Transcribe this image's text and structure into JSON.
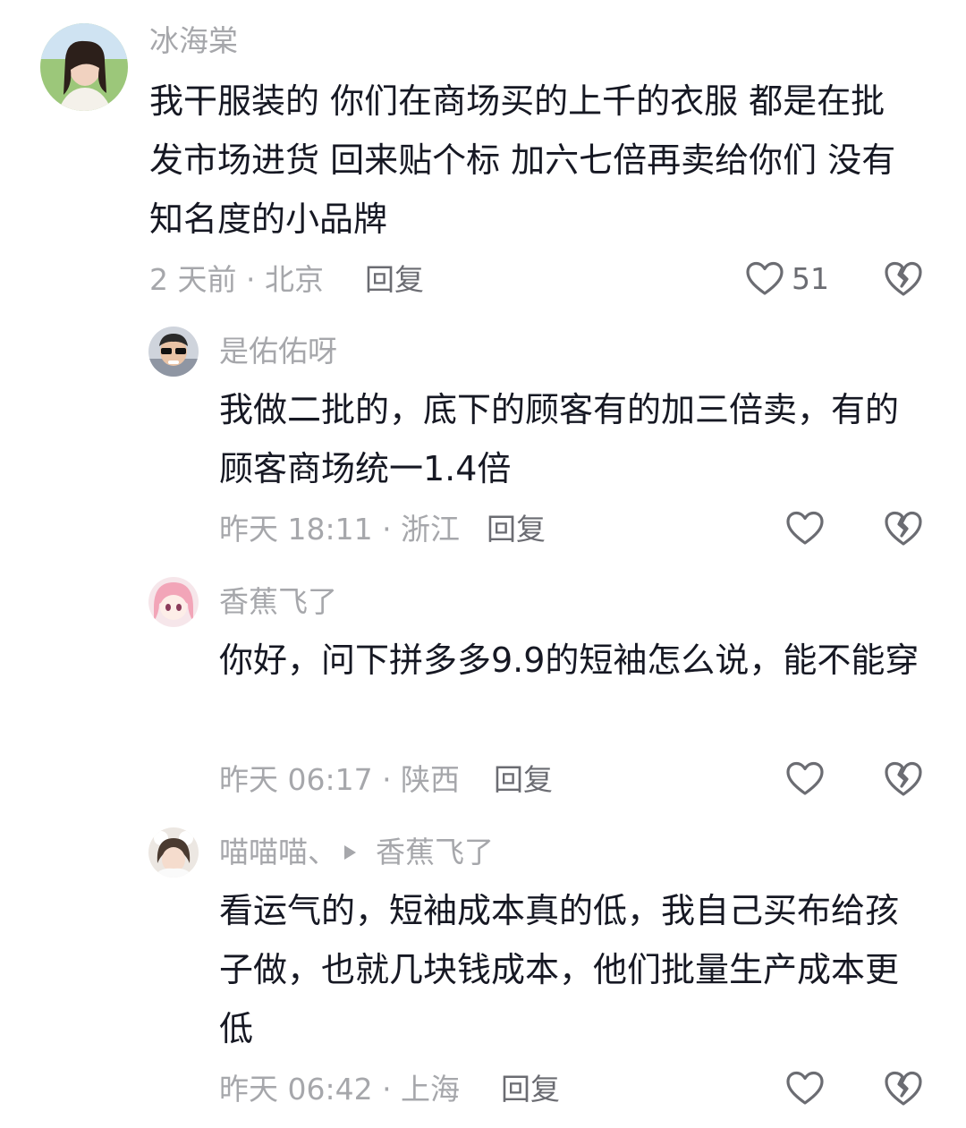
{
  "comments": [
    {
      "username": "冰海棠",
      "text": "我干服装的 你们在商场买的上千的衣服 都是在批发市场进货 回来贴个标 加六七倍再卖给你们 没有知名度的小品牌",
      "meta": "2 天前 · 北京",
      "reply_label": "回复",
      "likes": "51"
    },
    {
      "username": "是佑佑呀",
      "text": "我做二批的，底下的顾客有的加三倍卖，有的顾客商场统一1.4倍",
      "meta": "昨天 18:11 · 浙江",
      "reply_label": "回复",
      "likes": ""
    },
    {
      "username": "香蕉飞了",
      "text": "你好，问下拼多多9.9的短袖怎么说，能不能穿",
      "meta": "昨天 06:17 · 陕西",
      "reply_label": "回复",
      "likes": ""
    },
    {
      "username": "喵喵喵、",
      "reply_to": "香蕉飞了",
      "text": "看运气的，短袖成本真的低，我自己买布给孩子做，也就几块钱成本，他们批量生产成本更低",
      "meta": "昨天 06:42 · 上海",
      "reply_label": "回复",
      "likes": ""
    }
  ],
  "icons": {
    "like": "heart-outline-icon",
    "dislike": "broken-heart-icon"
  },
  "colors": {
    "text": "#161823",
    "secondary": "#a6a7ab",
    "action": "#6b6c72"
  }
}
